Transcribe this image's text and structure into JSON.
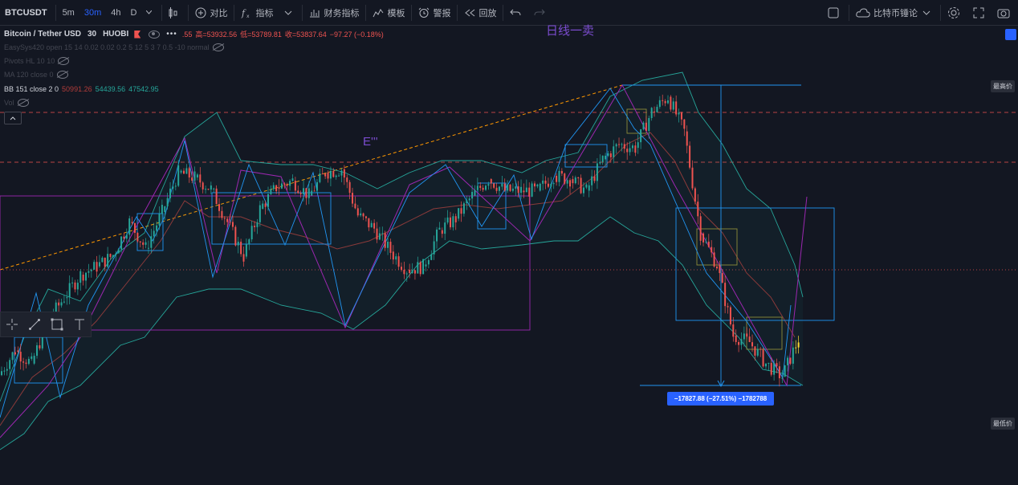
{
  "toolbar": {
    "symbol": "BTCUSDT",
    "intervals": [
      "5m",
      "30m",
      "4h",
      "D"
    ],
    "active_interval": "30m",
    "compare": "对比",
    "indicators": "指标",
    "financials": "财务指标",
    "templates": "模板",
    "alert": "警报",
    "replay": "回放",
    "layout_name": "比特币锤论"
  },
  "legend": {
    "title": "Bitcoin / Tether USD",
    "interval": "30",
    "exchange": "HUOBI",
    "open_partial": ".55",
    "high_label": "高=53932.56",
    "low_label": "低=53789.81",
    "close_label": "收=53837.64",
    "change": "−97.27 (−0.18%)",
    "easysys": "EasySys420 open 15 14 0.02 0.02 0.2 5 12 5 3 7 0.5 -10 normal",
    "pivots": "Pivots HL 10 10",
    "ma": "MA 120 close 0",
    "bb_label": "BB 151 close 2 0",
    "bb_upper": "50991.26",
    "bb_basis": "54439.56",
    "bb_lower": "47542.95",
    "vol": "Vol"
  },
  "annotations": {
    "daily_sell": "日线一卖",
    "e_label": "E'''",
    "measure": "−17827.88 (−27.51%) −1782788"
  },
  "axis": {
    "high_badge": "最高价",
    "low_badge": "最低价"
  },
  "colors": {
    "background": "#131722",
    "candle_up": "#26a69a",
    "candle_down": "#ef5350",
    "bb_band": "#26a69a",
    "ma": "#8b3a3a",
    "zigzag_purple": "#9c27b0",
    "zigzag_blue": "#2196f3",
    "trend_orange": "#ff9800",
    "accent_blue": "#2962ff",
    "annotation_purple": "#7b4ccf",
    "last_candle": "#fdd835"
  },
  "chart_data": {
    "type": "candlestick",
    "series": [
      {
        "name": "BTCUSDT",
        "values": [
          47600,
          49100,
          48300,
          50900,
          52300,
          53700,
          54200,
          54900,
          56900,
          55300,
          57500,
          59900,
          59600,
          58900,
          56900,
          54800,
          57700,
          59000,
          59400,
          58500,
          59900,
          60100,
          57300,
          56500,
          55100,
          54000,
          54200,
          56400,
          57100,
          58500,
          59500,
          58800,
          58800,
          58800,
          59700,
          59500,
          58800,
          60700,
          61600,
          61400,
          63600,
          64500,
          62400,
          56200,
          54300,
          50000,
          49600,
          48300,
          47500,
          49800
        ]
      }
    ],
    "ylim": [
      46000,
      65500
    ],
    "x_steps": 50
  }
}
